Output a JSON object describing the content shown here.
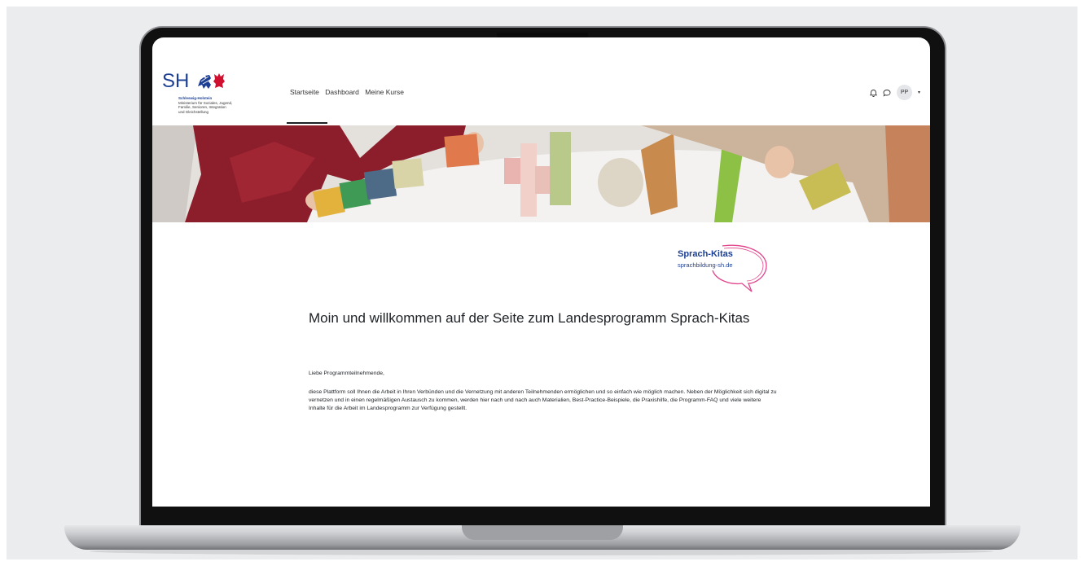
{
  "site": {
    "logo": {
      "wordmark": "SH",
      "state": "Schleswig-Holstein",
      "ministry_lines": [
        "Ministerium für Soziales, Jugend,",
        "Familie, Senioren, Integration",
        "und Gleichstellung"
      ]
    },
    "nav": [
      "Startseite",
      "Dashboard",
      "Meine Kurse"
    ],
    "header_icons": [
      "bell-icon",
      "chat-icon"
    ],
    "avatar_initials": "PP"
  },
  "program_logo": {
    "title": "Sprach-Kitas",
    "subtitle": "sprachbildung-sh.de",
    "accent": "#e0458c"
  },
  "content": {
    "heading": "Moin und willkommen auf der Seite zum Landesprogramm Sprach-Kitas",
    "greeting": "Liebe Programmteilnehmende,",
    "paragraph": "diese Plattform soll Ihnen die Arbeit in Ihren Verbünden und die Vernetzung mit anderen Teilnehmenden ermöglichen und so einfach wie möglich machen. Neben der Möglichkeit sich digital zu vernetzen und in einen regelmäßigen Austausch zu kommen, werden hier nach und nach auch Materialien, Best-Practice-Beispiele, die Praxishilfe, die Programm-FAQ und viele weitere Inhalte für die Arbeit im Landesprogramm zur Verfügung gestellt."
  },
  "colors": {
    "brand_blue": "#1c3f94",
    "brand_red": "#d1102f"
  }
}
